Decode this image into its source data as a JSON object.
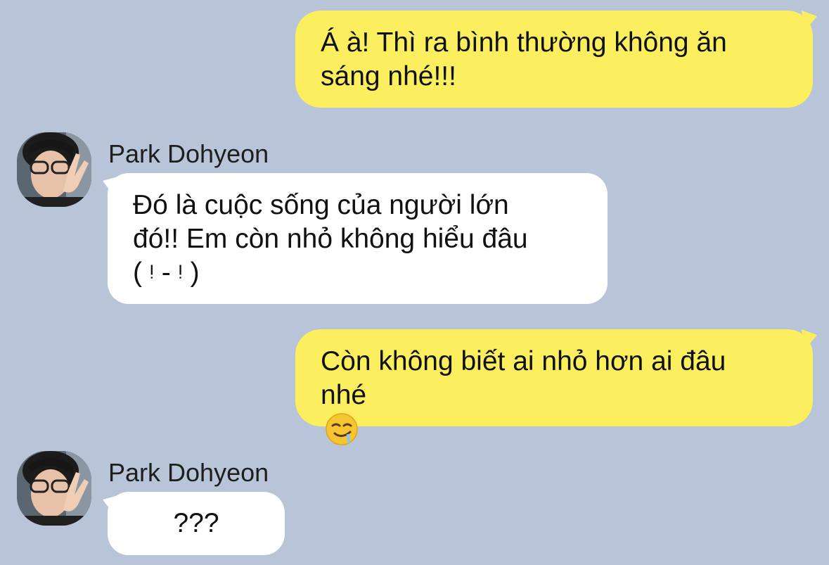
{
  "messages": [
    {
      "direction": "outgoing",
      "text": "Á à! Thì ra bình thường không ăn\nsáng nhé!!!"
    },
    {
      "direction": "incoming",
      "sender": "Park Dohyeon",
      "text": "Đó là cuộc sống của người lớn\nđó!! Em còn nhỏ không hiểu đâu\n( ᵎ - ᵎ )"
    },
    {
      "direction": "outgoing",
      "text": "Còn không biết ai nhỏ hơn ai đâu\nnhé",
      "emoji": "drooling-face-emoji"
    },
    {
      "direction": "incoming",
      "sender": "Park Dohyeon",
      "text": "???"
    }
  ],
  "colors": {
    "background": "#b8c5d9",
    "outgoing_bubble": "#fbef5f",
    "incoming_bubble": "#ffffff"
  }
}
